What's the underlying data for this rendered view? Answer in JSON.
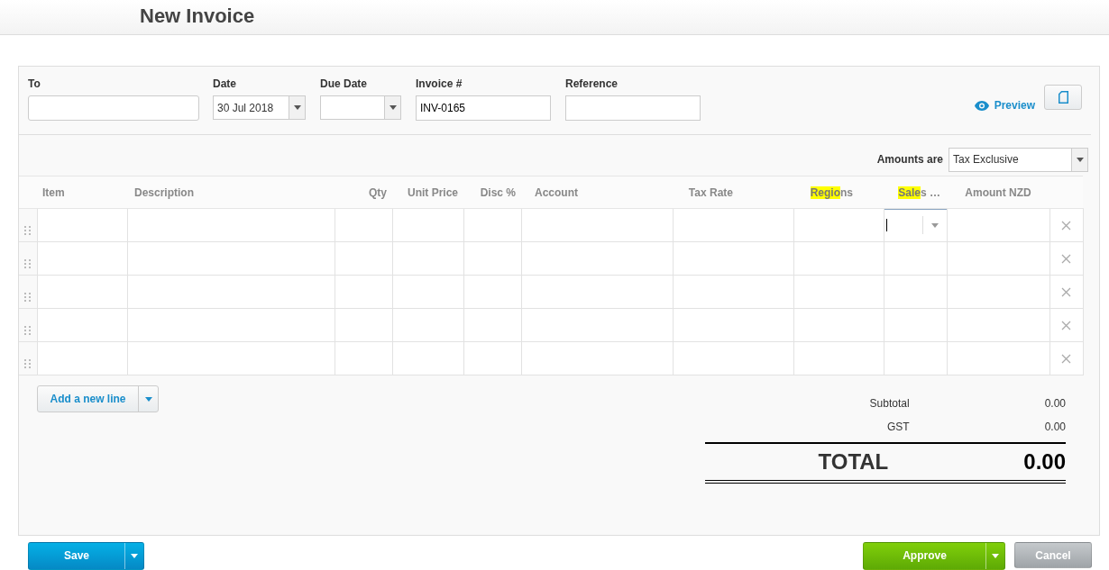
{
  "page_title": "New Invoice",
  "fields": [
    {
      "kind": "text",
      "label": "To"
    },
    {
      "kind": "date",
      "label": "Date",
      "value": "30 Jul 2018"
    },
    {
      "kind": "date",
      "label": "Due Date"
    },
    {
      "kind": "text",
      "label": "Invoice #",
      "value": "INV-0165"
    },
    {
      "kind": "text",
      "label": "Reference"
    }
  ],
  "preview_link": "Preview",
  "amounts": {
    "label": "Amounts are",
    "value": "Tax Exclusive"
  },
  "columns": [
    {
      "parts": [
        {
          "text": "Item",
          "highlight": false
        }
      ]
    },
    {
      "parts": [
        {
          "text": "Description",
          "highlight": false
        }
      ]
    },
    {
      "parts": [
        {
          "text": "Qty",
          "highlight": false
        }
      ]
    },
    {
      "parts": [
        {
          "text": "Unit Price",
          "highlight": false
        }
      ]
    },
    {
      "parts": [
        {
          "text": "Disc %",
          "highlight": false
        }
      ]
    },
    {
      "parts": [
        {
          "text": "Account",
          "highlight": false
        }
      ]
    },
    {
      "parts": [
        {
          "text": "Tax Rate",
          "highlight": false
        }
      ]
    },
    {
      "parts": [
        {
          "text": "Regio",
          "highlight": true
        },
        {
          "text": "ns",
          "highlight": false
        }
      ]
    },
    {
      "parts": [
        {
          "text": "Sale",
          "highlight": true
        },
        {
          "text": "s …",
          "highlight": false
        }
      ]
    },
    {
      "parts": [
        {
          "text": "Amount NZD",
          "highlight": false
        }
      ]
    }
  ],
  "rows": [
    {
      "sales_focused": true
    },
    {
      "sales_focused": false
    },
    {
      "sales_focused": false
    },
    {
      "sales_focused": false
    },
    {
      "sales_focused": false
    }
  ],
  "add_line_button": "Add a new line",
  "totals": [
    {
      "kind": "line",
      "label": "Subtotal",
      "value": "0.00"
    },
    {
      "kind": "line",
      "label": "GST",
      "value": "0.00"
    },
    {
      "kind": "grand",
      "label": "TOTAL",
      "value": "0.00"
    }
  ],
  "save_button": "Save",
  "approve_button": "Approve",
  "cancel_button": "Cancel"
}
